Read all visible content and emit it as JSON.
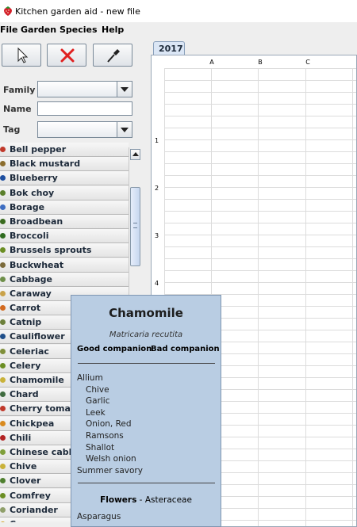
{
  "window": {
    "title": "Kitchen garden aid - new file"
  },
  "menu": [
    "File",
    "Garden",
    "Species",
    "Help"
  ],
  "toolbar": {
    "select": "select-tool",
    "delete": "delete-tool",
    "pick": "eyedropper-tool"
  },
  "filters": {
    "family_label": "Family",
    "name_label": "Name",
    "tag_label": "Tag",
    "name_value": ""
  },
  "species": [
    "Bell pepper",
    "Black mustard",
    "Blueberry",
    "Bok choy",
    "Borage",
    "Broadbean",
    "Broccoli",
    "Brussels sprouts",
    "Buckwheat",
    "Cabbage",
    "Caraway",
    "Carrot",
    "Catnip",
    "Cauliflower",
    "Celeriac",
    "Celery",
    "Chamomile",
    "Chard",
    "Cherry tomato",
    "Chickpea",
    "Chili",
    "Chinese cabbage",
    "Chive",
    "Clover",
    "Comfrey",
    "Coriander",
    "Corn"
  ],
  "species_colors": [
    "#c0392b",
    "#8b6d2e",
    "#1e4fa0",
    "#5a7f2b",
    "#3d6dc1",
    "#3a6b1f",
    "#2e6b1e",
    "#6b8e23",
    "#7b6a3a",
    "#6e8f4a",
    "#c9a24a",
    "#d2691e",
    "#6b7f3a",
    "#1f4f8a",
    "#7f8f3a",
    "#6b8e23",
    "#c9b23a",
    "#3f6b3f",
    "#c0392b",
    "#d98a1e",
    "#b22222",
    "#7f9f3a",
    "#c9b23a",
    "#4f7f2f",
    "#6b8e23",
    "#8f9f6a",
    "#d2a21e"
  ],
  "plan": {
    "tab": "2017",
    "columns": [
      "A",
      "B",
      "C"
    ],
    "rows": [
      "1",
      "2",
      "3",
      "4"
    ]
  },
  "popup": {
    "name": "Chamomile",
    "latin": "Matricaria recutita",
    "good_label": "Good companion",
    "bad_label": "Bad companion",
    "good_list": [
      {
        "text": "Allium",
        "indent": false
      },
      {
        "text": "Chive",
        "indent": true
      },
      {
        "text": "Garlic",
        "indent": true
      },
      {
        "text": "Leek",
        "indent": true
      },
      {
        "text": "Onion, Red",
        "indent": true
      },
      {
        "text": "Ramsons",
        "indent": true
      },
      {
        "text": "Shallot",
        "indent": true
      },
      {
        "text": "Welsh onion",
        "indent": true
      },
      {
        "text": "Summer savory",
        "indent": false
      }
    ],
    "family_label": "Flowers",
    "family_sep": "-",
    "family": "Asteraceae",
    "below_family": "Asparagus"
  }
}
